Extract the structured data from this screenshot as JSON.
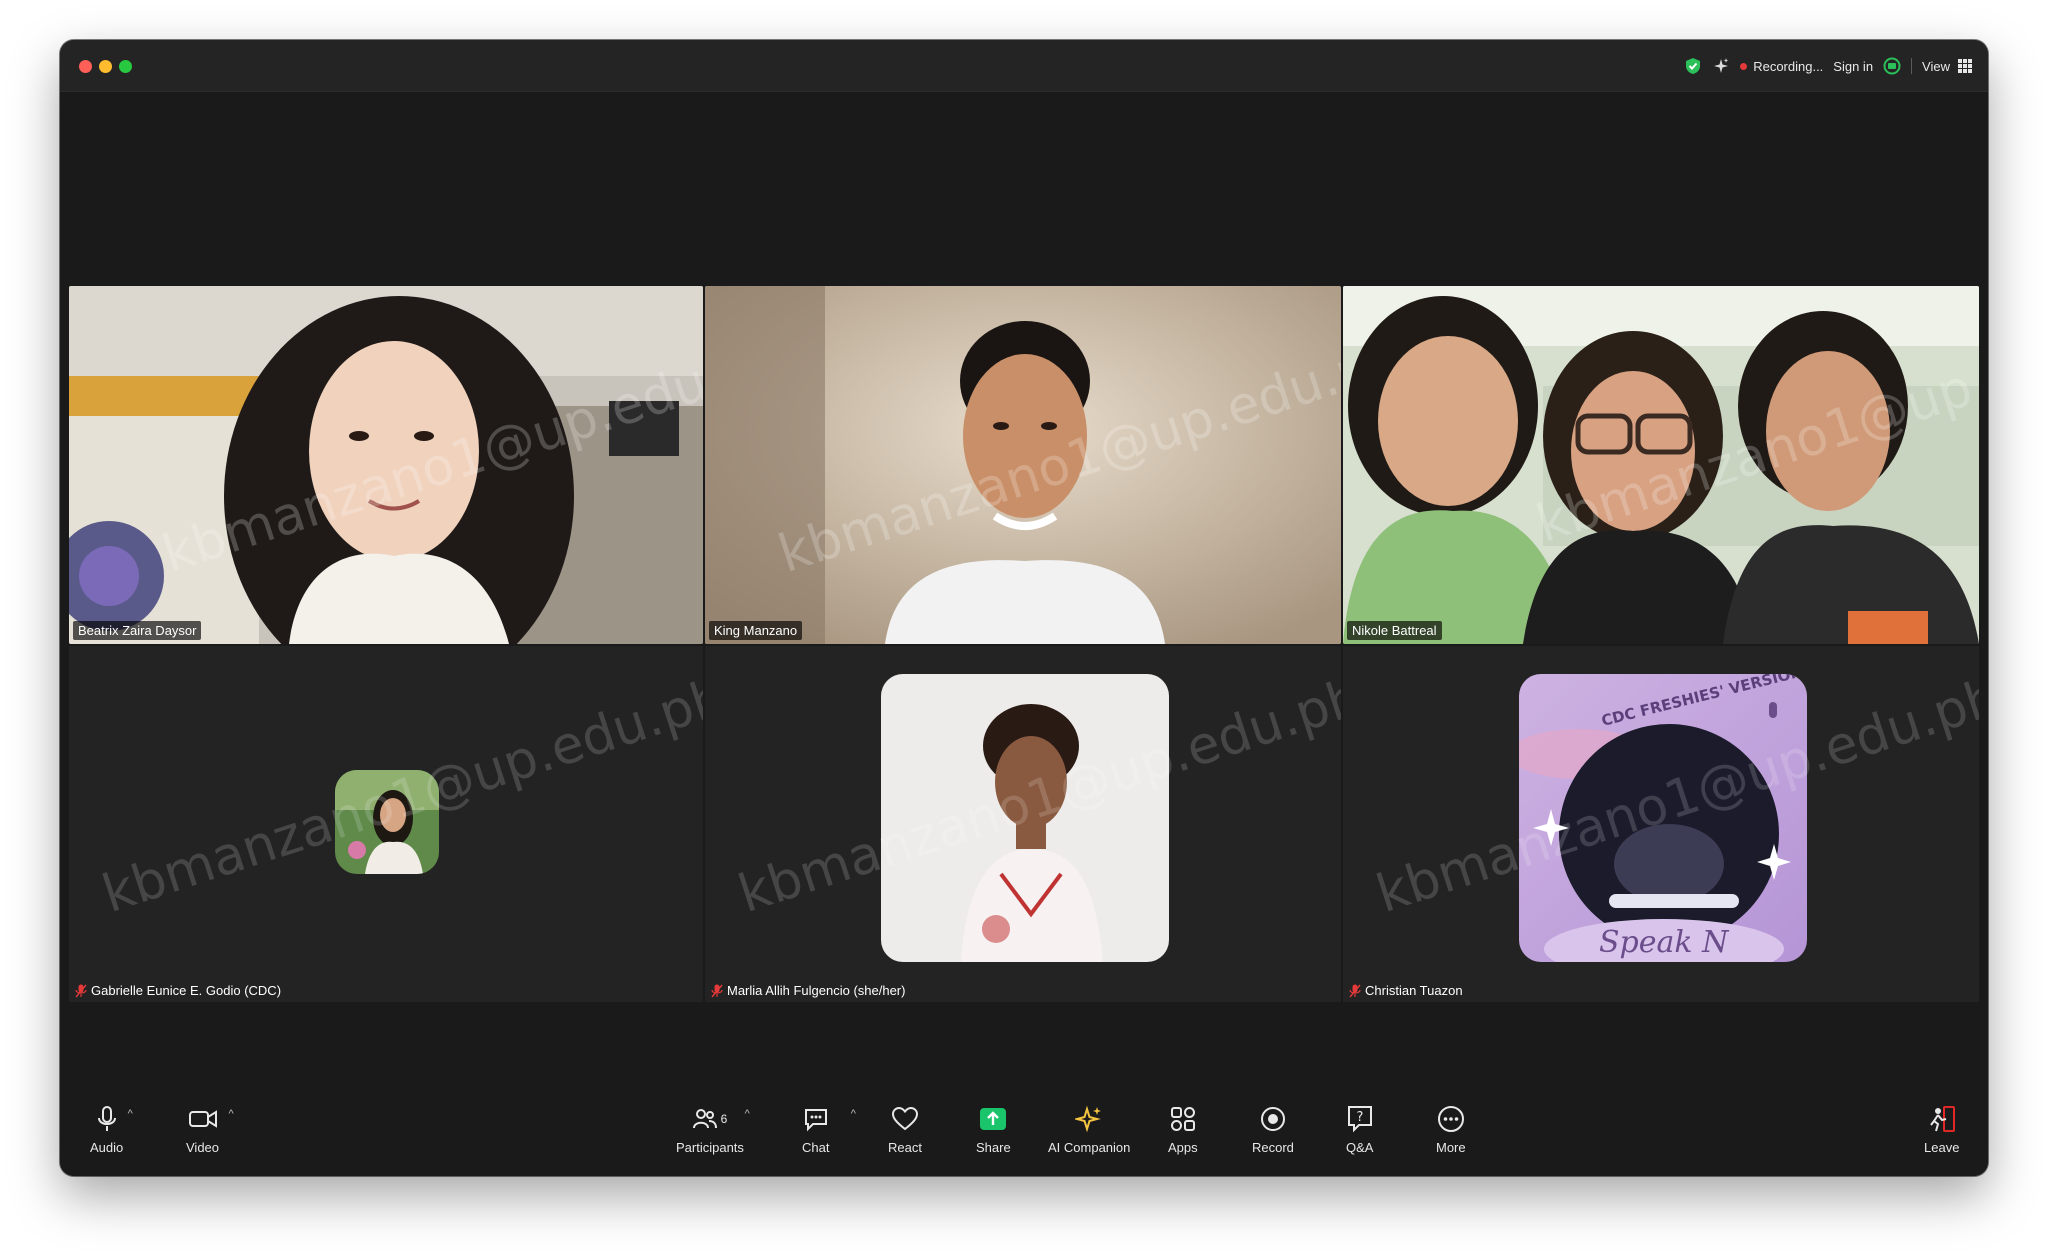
{
  "window": {
    "traffic_lights": [
      "close",
      "minimize",
      "zoom"
    ]
  },
  "topbar": {
    "recording_label": "Recording...",
    "sign_in_label": "Sign in",
    "view_label": "View"
  },
  "watermark_text": "kbmanzano1@up.edu.ph",
  "participants": [
    {
      "name": "Beatrix Zaira Daysor",
      "type": "video",
      "muted": false,
      "active_speaker": false
    },
    {
      "name": "King Manzano",
      "type": "video",
      "muted": false,
      "active_speaker": true
    },
    {
      "name": "Nikole Battreal",
      "type": "video",
      "muted": false,
      "active_speaker": false
    },
    {
      "name": "Gabrielle Eunice E. Godio (CDC)",
      "type": "avatar",
      "muted": true,
      "active_speaker": false
    },
    {
      "name": "Marlia Allih Fulgencio (she/her)",
      "type": "avatar",
      "muted": true,
      "active_speaker": false
    },
    {
      "name": "Christian Tuazon",
      "type": "avatar",
      "muted": true,
      "active_speaker": false
    }
  ],
  "avatar_art_text": [
    "CDC FRESHIES' VERSION",
    "Speak N"
  ],
  "more_options_badge": "...",
  "toolbar": {
    "audio_label": "Audio",
    "video_label": "Video",
    "participants_label": "Participants",
    "participants_count": "6",
    "chat_label": "Chat",
    "react_label": "React",
    "share_label": "Share",
    "ai_companion_label": "AI Companion",
    "apps_label": "Apps",
    "record_label": "Record",
    "qa_label": "Q&A",
    "more_label": "More",
    "leave_label": "Leave"
  },
  "colors": {
    "background": "#1a1a1a",
    "active_border": "#39c14a",
    "share_green": "#19c46a",
    "record_red": "#e5393a",
    "leave_red": "#e02828",
    "ai_yellow": "#f5c542",
    "badge_blue": "#1f6fd8"
  }
}
